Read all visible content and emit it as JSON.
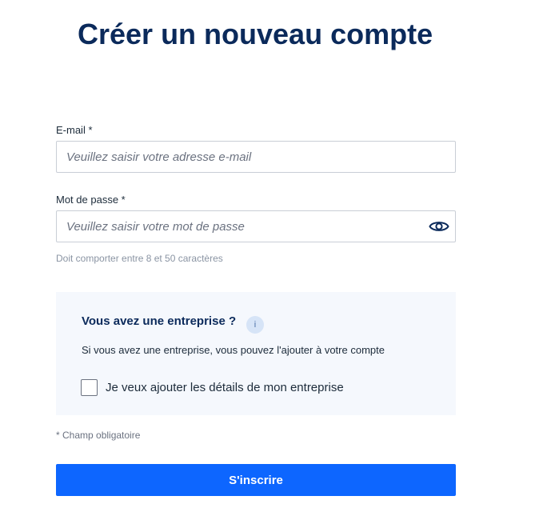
{
  "page": {
    "title": "Créer un nouveau compte"
  },
  "form": {
    "email": {
      "label": "E-mail *",
      "placeholder": "Veuillez saisir votre adresse e-mail",
      "value": ""
    },
    "password": {
      "label": "Mot de passe *",
      "placeholder": "Veuillez saisir votre mot de passe",
      "value": "",
      "hint": "Doit comporter entre 8 et 50 caractères",
      "toggle_icon": "eye-icon"
    },
    "company": {
      "title": "Vous avez une entreprise ?",
      "info_icon_text": "i",
      "description": "Si vous avez une entreprise, vous pouvez l'ajouter à votre compte",
      "checkbox_label": "Je veux ajouter les détails de mon entreprise",
      "checked": false
    },
    "required_note": "* Champ obligatoire",
    "submit_label": "S'inscrire"
  },
  "colors": {
    "title": "#0b2a5b",
    "primary": "#0d66ff",
    "panel_bg": "#f5f8fd"
  }
}
